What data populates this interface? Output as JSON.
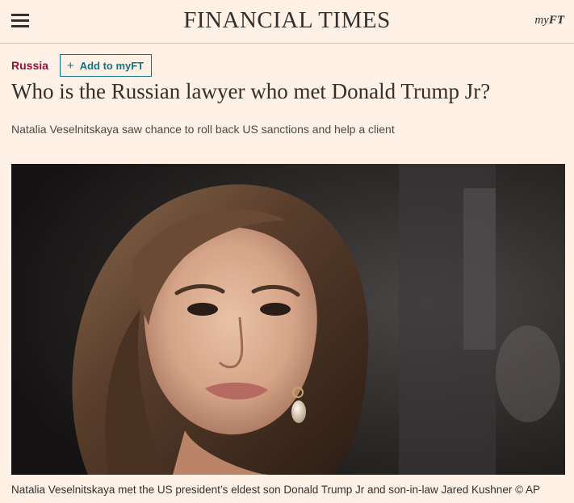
{
  "header": {
    "masthead": "FINANCIAL TIMES",
    "myft_prefix": "my",
    "myft_suffix": "FT",
    "menu_icon": "hamburger-menu-icon"
  },
  "article": {
    "topic": "Russia",
    "add_to_myft": "Add to myFT",
    "add_icon": "plus-icon",
    "headline": "Who is the Russian lawyer who met Donald Trump Jr?",
    "standfirst": "Natalia Veselnitskaya saw chance to roll back US sanctions and help a client",
    "caption": "Natalia Veselnitskaya met the US president’s eldest son Donald Trump Jr and son-in-law Jared Kushner © AP"
  },
  "colors": {
    "background": "#fff1e5",
    "topic": "#990f3d",
    "myft_accent": "#0d7680",
    "text": "#33302e"
  }
}
